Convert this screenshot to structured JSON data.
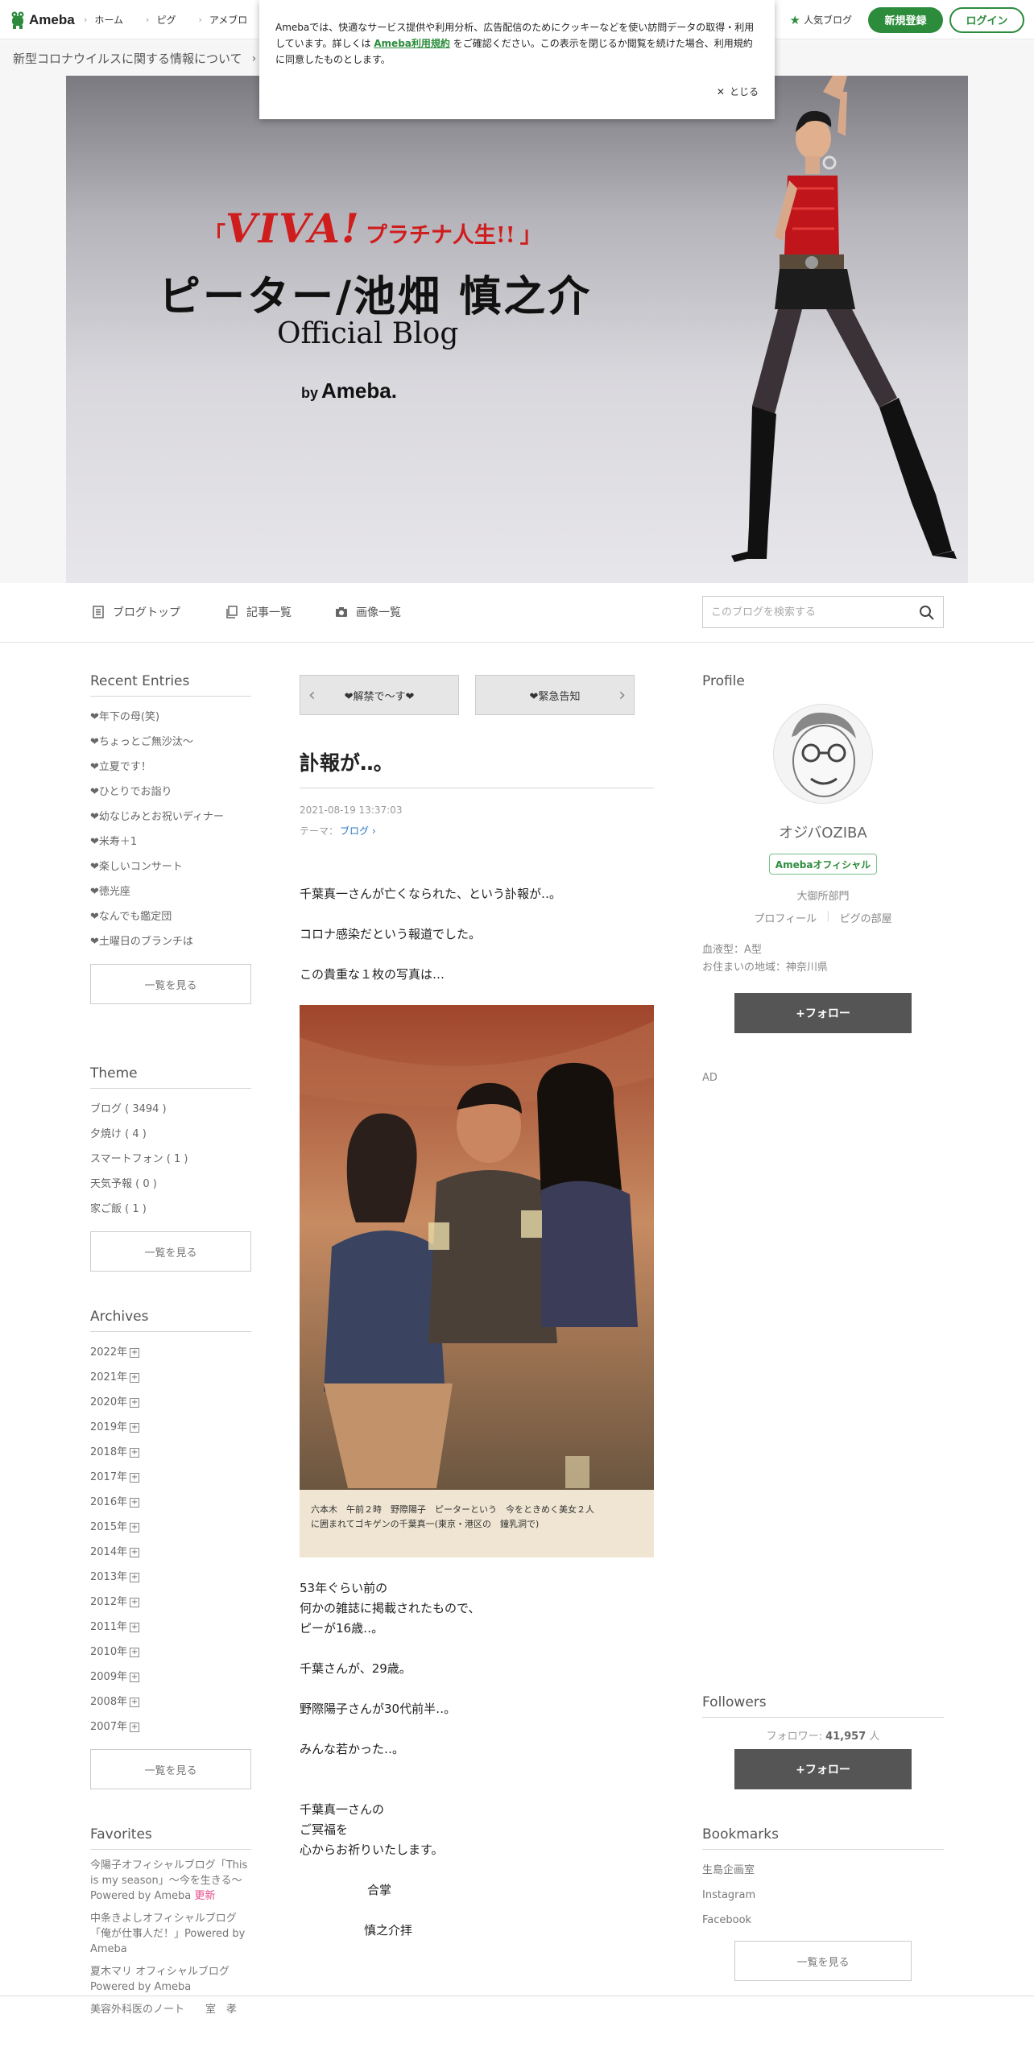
{
  "header": {
    "logo": "Ameba",
    "nav": [
      "ホーム",
      "ピグ",
      "アメブロ"
    ],
    "popular": "人気ブログ",
    "register": "新規登録",
    "login": "ログイン"
  },
  "notice": {
    "covid": "新型コロナウイルスに関する情報について"
  },
  "cookie": {
    "text_before": "Amebaでは、快適なサービス提供や利用分析、広告配信のためにクッキーなどを使い訪問データの取得・利用しています。詳しくは ",
    "link": "Ameba利用規約",
    "text_after": " をご確認ください。この表示を閉じるか閲覧を続けた場合、利用規約に同意したものとします。",
    "close": "とじる"
  },
  "hero": {
    "viva": "VIVA!",
    "viva_sub": "プラチナ人生!!",
    "name": "ピーター/池畑 慎之介",
    "official": "Official Blog",
    "by": "by",
    "ameba": "Ameba."
  },
  "blognav": {
    "top": "ブログトップ",
    "entries": "記事一覧",
    "images": "画像一覧",
    "search_placeholder": "このブログを検索する"
  },
  "left": {
    "recent_title": "Recent Entries",
    "recent": [
      "❤年下の母(笑)",
      "❤ちょっとご無沙汰～",
      "❤立夏です！",
      "❤ひとりでお詣り",
      "❤幼なじみとお祝いディナー",
      "❤米寿＋1",
      "❤楽しいコンサート",
      "❤徳光座",
      "❤なんでも鑑定団",
      "❤土曜日のブランチは"
    ],
    "more": "一覧を見る",
    "theme_title": "Theme",
    "themes": [
      "ブログ ( 3494 )",
      "夕焼け ( 4 )",
      "スマートフォン ( 1 )",
      "天気予報 ( 0 )",
      "家ご飯 ( 1 )"
    ],
    "archives_title": "Archives",
    "archives": [
      "2022年",
      "2021年",
      "2020年",
      "2019年",
      "2018年",
      "2017年",
      "2016年",
      "2015年",
      "2014年",
      "2013年",
      "2012年",
      "2011年",
      "2010年",
      "2009年",
      "2008年",
      "2007年"
    ],
    "favorites_title": "Favorites",
    "favorites": [
      {
        "text": "今陽子オフィシャルブログ「This is my season」～今を生きる～Powered by Ameba",
        "badge": "更新"
      },
      {
        "text": "中条きよしオフィシャルブログ「俺が仕事人だ！」Powered by Ameba",
        "badge": ""
      },
      {
        "text": "夏木マリ オフィシャルブログ Powered by Ameba",
        "badge": ""
      },
      {
        "text": "美容外科医のノート　　室　孝",
        "badge": ""
      }
    ]
  },
  "main": {
    "prev": "❤解禁で～す❤",
    "next": "❤緊急告知",
    "title": "訃報が‥。",
    "date": "2021-08-19 13:37:03",
    "theme_label": "テーマ：",
    "theme": "ブログ",
    "p1": "千葉真一さんが亡くなられた、という訃報が‥。",
    "p2": "コロナ感染だという報道でした。",
    "p3": "この貴重な１枚の写真は…",
    "caption_1": "六本木　午前２時　野際陽子　ピーターという　今をときめく美女２人",
    "caption_2": "に囲まれてゴキゲンの千葉真一(東京・港区の　鐘乳洞で)",
    "p4": [
      "53年ぐらい前の",
      "何かの雑誌に掲載されたもので、",
      "ピーが16歳‥。"
    ],
    "p5": "千葉さんが、29歳。",
    "p6": "野際陽子さんが30代前半‥。",
    "p7": "みんな若かった‥。",
    "p8": [
      "千葉真一さんの",
      "ご冥福を",
      "心からお祈りいたします。"
    ],
    "closing": "合掌",
    "sign": "慎之介拝"
  },
  "right": {
    "profile_title": "Profile",
    "name": "オジバOZIBA",
    "badge": "Amebaオフィシャル",
    "dept": "大御所部門",
    "link_profile": "プロフィール",
    "link_pig": "ピグの部屋",
    "blood": "血液型：A型",
    "area": "お住まいの地域：神奈川県",
    "follow": "+フォロー",
    "ad": "AD",
    "followers_title": "Followers",
    "followers_label": "フォロワー:",
    "followers_count": "41,957",
    "followers_unit": "人",
    "bookmarks_title": "Bookmarks",
    "bookmarks": [
      "生島企画室",
      "Instagram",
      "Facebook"
    ],
    "more": "一覧を見る"
  },
  "colors": {
    "brand_green": "#2d8c3c",
    "follow_btn": "#555555",
    "update_pink": "#e64a8a"
  }
}
